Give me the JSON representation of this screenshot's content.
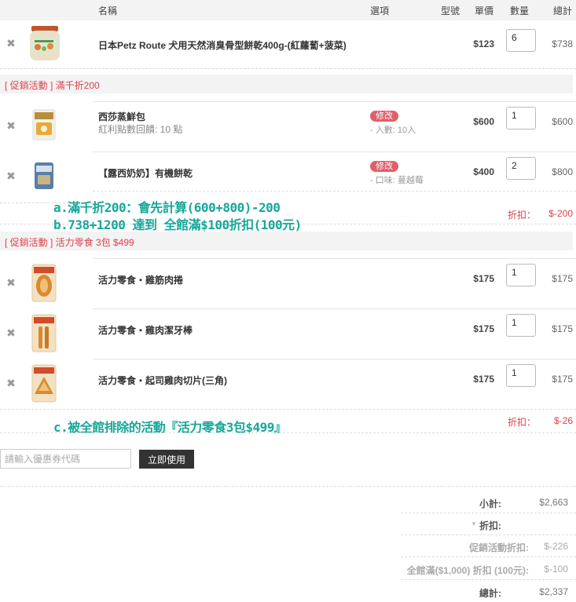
{
  "header": {
    "name": "名稱",
    "options": "選項",
    "model": "型號",
    "unit_price": "單價",
    "quantity": "數量",
    "total": "總計"
  },
  "items_top": [
    {
      "name": "日本Petz Route 犬用天然消臭骨型餅乾400g-(紅蘿蔔+菠菜)",
      "price": "$123",
      "qty": "6",
      "total": "$738"
    }
  ],
  "promo1": {
    "title": "[ 促銷活動 ] 滿千折200",
    "items": [
      {
        "name": "西莎蒸鮮包",
        "note": "紅利點數回饋: 10 點",
        "edit": "修改",
        "option": "- 入數: 10入",
        "price": "$600",
        "qty": "1",
        "total": "$600"
      },
      {
        "name": "【露西奶奶】有機餅乾",
        "edit": "修改",
        "option": "- 口味: 蔓越莓",
        "price": "$400",
        "qty": "2",
        "total": "$800"
      }
    ],
    "discount_label": "折扣：",
    "discount_value": "$-200"
  },
  "promo2": {
    "title": "[ 促銷活動 ] 活力零食 3包 $499",
    "items": [
      {
        "name": "活力零食・雞筋肉捲",
        "price": "$175",
        "qty": "1",
        "total": "$175"
      },
      {
        "name": "活力零食・雞肉潔牙棒",
        "price": "$175",
        "qty": "1",
        "total": "$175"
      },
      {
        "name": "活力零食・起司雞肉切片(三角)",
        "price": "$175",
        "qty": "1",
        "total": "$175"
      }
    ],
    "discount_label": "折扣：",
    "discount_value": "$-26"
  },
  "annotations": {
    "line_a": "a.滿千折200：會先計算(600+800)-200",
    "line_b": "b.738+1200 達到 全館滿$100折扣(100元)",
    "line_c": "c.被全館排除的活動『活力零食3包$499』"
  },
  "coupon": {
    "placeholder": "請輸入優惠券代碼",
    "apply_label": "立即使用"
  },
  "summary": {
    "subtotal_label": "小計:",
    "subtotal_value": "$2,663",
    "discount_label": "折扣:",
    "promo_discount_label": "促銷活動折扣:",
    "promo_discount_value": "$-226",
    "store_discount_label": "全館滿($1,000) 折扣 (100元):",
    "store_discount_value": "$-100",
    "grand_total_label": "總計:",
    "grand_total_value": "$2,337"
  },
  "colors": {
    "accent_red": "#d9424c",
    "annotation_teal": "#16a79a",
    "header_bg": "#f3f3f3"
  }
}
